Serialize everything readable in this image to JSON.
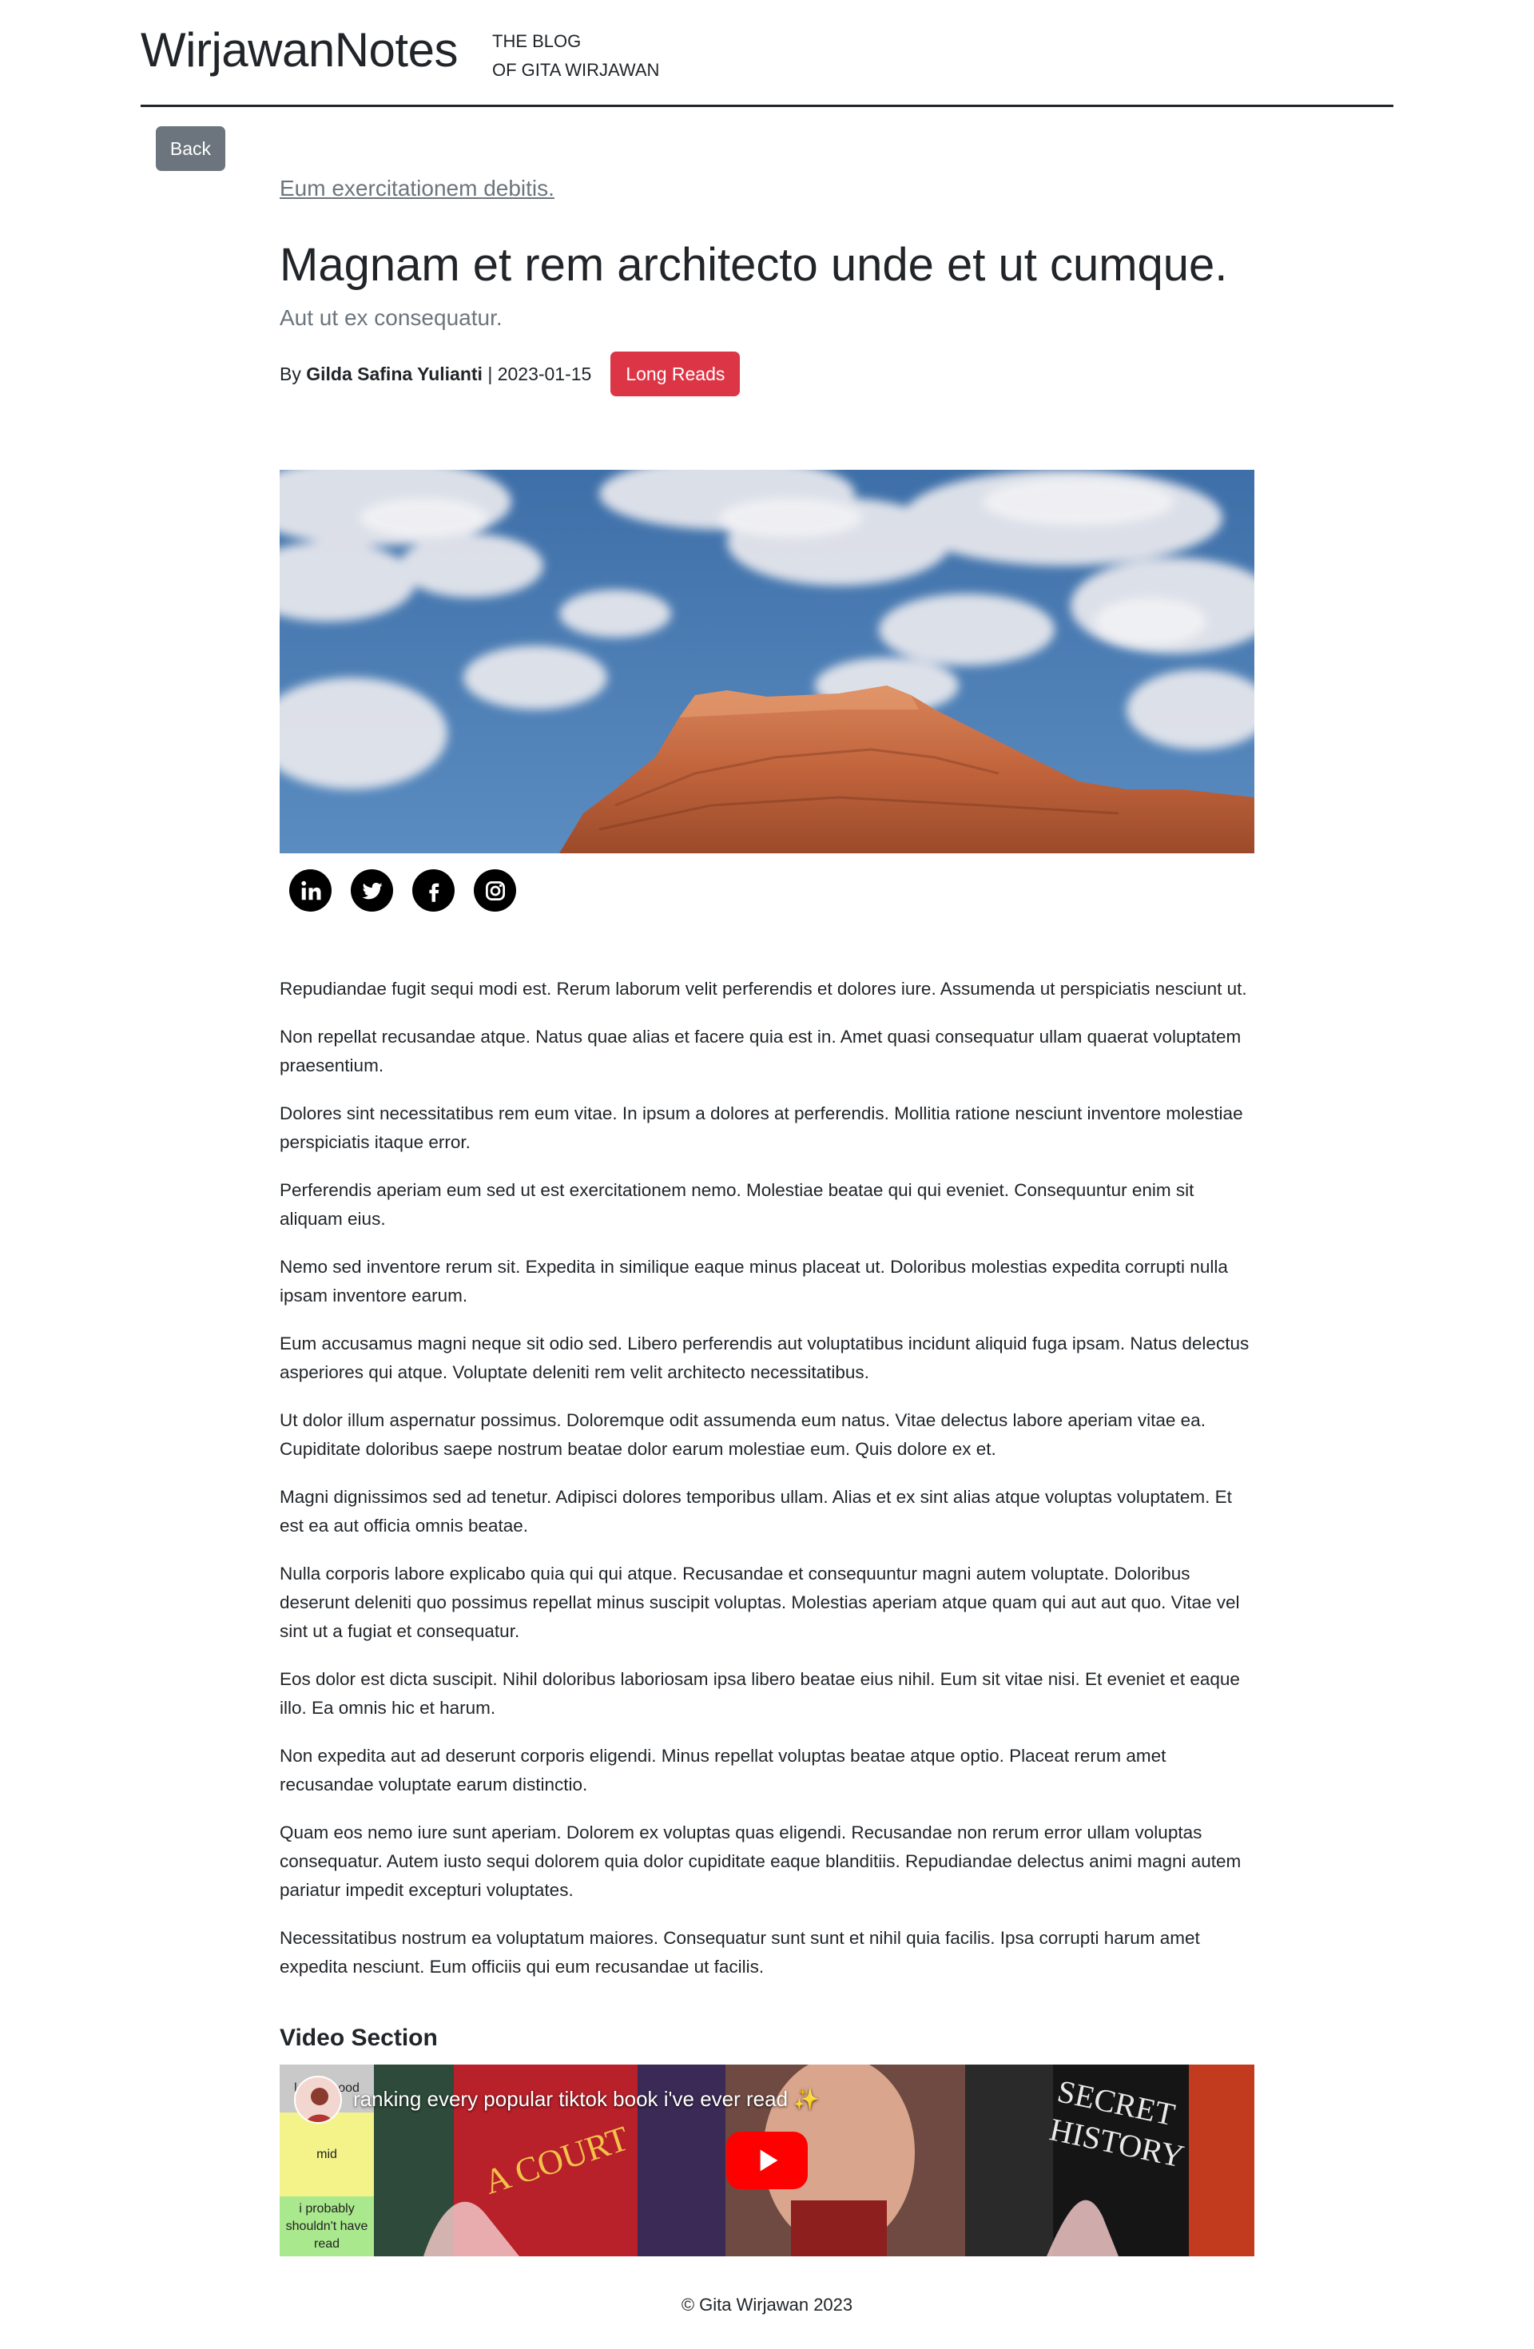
{
  "header": {
    "brand": "WirjawanNotes",
    "tagline_line1": "THE BLOG",
    "tagline_line2": "OF GITA WIRJAWAN"
  },
  "back_button": "Back",
  "article": {
    "category": "Eum exercitationem debitis.",
    "title": "Magnam et rem architecto unde et ut cumque.",
    "subtitle": "Aut ut ex consequatur.",
    "by_prefix": "By",
    "author": "Gilda Safina Yulianti",
    "date_separator": "| 2023-01-15",
    "badge": "Long Reads",
    "social_icons": [
      "linkedin-icon",
      "twitter-icon",
      "facebook-icon",
      "instagram-icon"
    ],
    "paragraphs": [
      "Repudiandae fugit sequi modi est. Rerum laborum velit perferendis et dolores iure. Assumenda ut perspiciatis nesciunt ut.",
      "Non repellat recusandae atque. Natus quae alias et facere quia est in. Amet quasi consequatur ullam quaerat voluptatem praesentium.",
      "Dolores sint necessitatibus rem eum vitae. In ipsum a dolores at perferendis. Mollitia ratione nesciunt inventore molestiae perspiciatis itaque error.",
      "Perferendis aperiam eum sed ut est exercitationem nemo. Molestiae beatae qui qui eveniet. Consequuntur enim sit aliquam eius.",
      "Nemo sed inventore rerum sit. Expedita in similique eaque minus placeat ut. Doloribus molestias expedita corrupti nulla ipsam inventore earum.",
      "Eum accusamus magni neque sit odio sed. Libero perferendis aut voluptatibus incidunt aliquid fuga ipsam. Natus delectus asperiores qui atque. Voluptate deleniti rem velit architecto necessitatibus.",
      "Ut dolor illum aspernatur possimus. Doloremque odit assumenda eum natus. Vitae delectus labore aperiam vitae ea. Cupiditate doloribus saepe nostrum beatae dolor earum molestiae eum. Quis dolore ex et.",
      "Magni dignissimos sed ad tenetur. Adipisci dolores temporibus ullam. Alias et ex sint alias atque voluptas voluptatem. Et est ea aut officia omnis beatae.",
      "Nulla corporis labore explicabo quia qui qui atque. Recusandae et consequuntur magni autem voluptate. Doloribus deserunt deleniti quo possimus repellat minus suscipit voluptas. Molestias aperiam atque quam qui aut aut quo. Vitae vel sint ut a fugiat et consequatur.",
      "Eos dolor est dicta suscipit. Nihil doloribus laboriosam ipsa libero beatae eius nihil. Eum sit vitae nisi. Et eveniet et eaque illo. Ea omnis hic et harum.",
      "Non expedita aut ad deserunt corporis eligendi. Minus repellat voluptas beatae atque optio. Placeat rerum amet recusandae voluptate earum distinctio.",
      "Quam eos nemo iure sunt aperiam. Dolorem ex voluptas quas eligendi. Recusandae non rerum error ullam voluptas consequatur. Autem iusto sequi dolorem quia dolor cupiditate eaque blanditiis. Repudiandae delectus animi magni autem pariatur impedit excepturi voluptates.",
      "Necessitatibus nostrum ea voluptatum maiores. Consequatur sunt sunt et nihil quia facilis. Ipsa corrupti harum amet expedita nesciunt. Eum officiis qui eum recusandae ut facilis."
    ],
    "video_heading": "Video Section",
    "video": {
      "title": "ranking every popular tiktok book i've ever read ✨",
      "tiers": [
        "loving good",
        "mid",
        "i probably shouldn't have read"
      ]
    }
  },
  "footer": "© Gita Wirjawan 2023"
}
